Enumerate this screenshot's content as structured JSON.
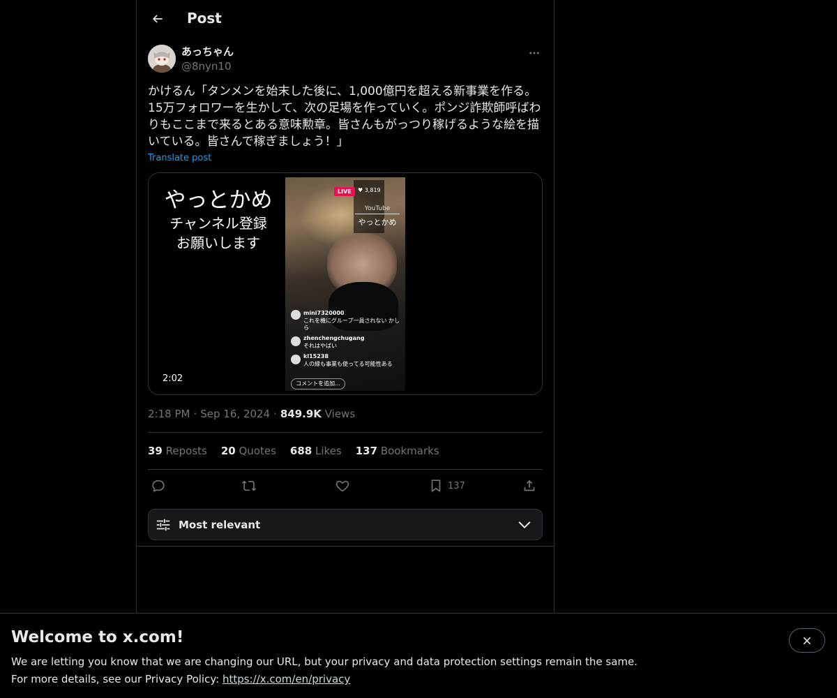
{
  "header": {
    "title": "Post",
    "back_icon": "arrow-left-icon"
  },
  "author": {
    "display_name": "あっちゃん",
    "handle": "@8nyn10"
  },
  "post": {
    "text": "かけるん「タンメンを始末した後に、1,000億円を超える新事業を作る。15万フォロワーを生かして、次の足場を作っていく。ポンジ詐欺師呼ばわりもここまで来るとある意味勲章。皆さんもがっつり稼げるような絵を描いている。皆さんで稼ぎましょう！」",
    "translate_label": "Translate post"
  },
  "media": {
    "overlay_line1": "やっとかめ",
    "overlay_line2": "チャンネル登録",
    "overlay_line3": "お願いします",
    "live_badge": "LIVE",
    "viewer_count": "♥ 3,819",
    "yt_label": "YouTube",
    "yt_name": "やっとかめ",
    "comment_user_1": "mini7320000",
    "comment_text_1": "これを機にグループ一員されない かしら",
    "comment_user_2": "zhenchengchugang",
    "comment_text_2": "それはやばい",
    "comment_user_3": "kl15238",
    "comment_text_3": "人の縁も事業も使ってる可能性ある",
    "comment_placeholder": "コメントを追加...",
    "duration": "2:02"
  },
  "meta": {
    "time": "2:18 PM",
    "date": "Sep 16, 2024",
    "views_count": "849.9K",
    "views_label": "Views"
  },
  "stats": {
    "reposts_count": "39",
    "reposts_label": "Reposts",
    "quotes_count": "20",
    "quotes_label": "Quotes",
    "likes_count": "688",
    "likes_label": "Likes",
    "bookmarks_count": "137",
    "bookmarks_label": "Bookmarks"
  },
  "actions": {
    "bookmark_count": "137"
  },
  "sort": {
    "label": "Most relevant"
  },
  "banner": {
    "title": "Welcome to x.com!",
    "line1": "We are letting you know that we are changing our URL, but your privacy and data protection settings remain the same.",
    "line2_prefix": "For more details, see our Privacy Policy: ",
    "link": "https://x.com/en/privacy"
  }
}
